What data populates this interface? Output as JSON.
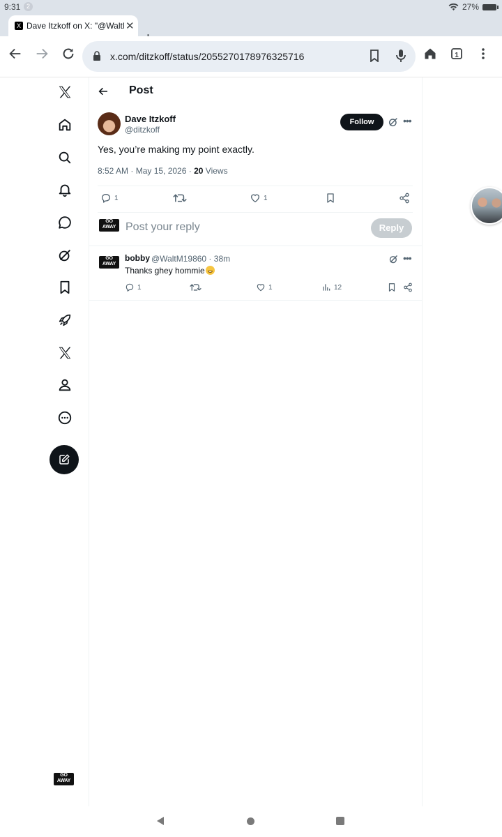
{
  "status_bar": {
    "time": "9:31",
    "notification_count": "2",
    "battery": "27%"
  },
  "browser": {
    "tab_title": "Dave Itzkoff on X: \"@WaltM1",
    "tab_favicon": "X",
    "url": "x.com/ditzkoff/status/2055270178976325716",
    "tab_count": "1"
  },
  "page": {
    "header_title": "Post",
    "tweet": {
      "author_name": "Dave Itzkoff",
      "author_handle": "@ditzkoff",
      "follow_label": "Follow",
      "text": "Yes, you’re making my point exactly.",
      "timestamp": "8:52 AM · May 15, 2026 · ",
      "views_count": "20",
      "views_label": "Views",
      "replies": "1",
      "likes": "1"
    },
    "composer": {
      "placeholder": "Post your reply",
      "reply_label": "Reply",
      "avatar_text": "GO AWAY"
    },
    "reply": {
      "author_name": "bobby",
      "meta": "@WaltM19860 · 38m",
      "text": "Thanks ghey hommie",
      "emoji": "grinning-face",
      "replies": "1",
      "likes": "1",
      "views": "12"
    }
  },
  "colors": {
    "text_primary": "#0f1419",
    "text_secondary": "#536471",
    "border": "#eff3f4",
    "button_dark": "#0f1419",
    "reply_disabled": "#c7cdd1"
  }
}
